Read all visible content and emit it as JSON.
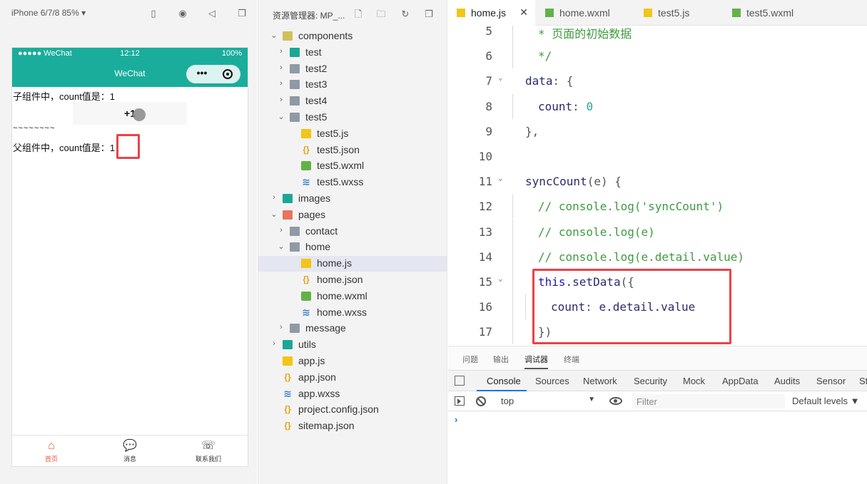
{
  "simulator": {
    "device": "iPhone 6/7/8 85% ▾",
    "status": {
      "carrier": "●●●●● WeChat",
      "time": "12:12",
      "battery": "100%"
    },
    "nav_title": "WeChat",
    "child_count_text": "子组件中，count值是：1",
    "plus_button": "+1",
    "separator": "~~~~~~~~",
    "parent_count_label": "父组件中，count值是：",
    "parent_count_value": "1",
    "tabs": [
      {
        "label": "首页",
        "icon": "home-icon",
        "active": true
      },
      {
        "label": "消息",
        "icon": "message-icon",
        "active": false
      },
      {
        "label": "联系我们",
        "icon": "contact-icon",
        "active": false
      }
    ]
  },
  "explorer": {
    "title": "资源管理器: MP_...",
    "tree": [
      {
        "label": "components",
        "type": "folder-comp",
        "chevron": "⌄",
        "level": 0
      },
      {
        "label": "test",
        "type": "folder-teal",
        "chevron": "›",
        "level": 1
      },
      {
        "label": "test2",
        "type": "folder",
        "chevron": "›",
        "level": 1
      },
      {
        "label": "test3",
        "type": "folder",
        "chevron": "›",
        "level": 1
      },
      {
        "label": "test4",
        "type": "folder",
        "chevron": "›",
        "level": 1
      },
      {
        "label": "test5",
        "type": "folder",
        "chevron": "⌄",
        "level": 1
      },
      {
        "label": "test5.js",
        "type": "js",
        "chevron": "",
        "level": 2
      },
      {
        "label": "test5.json",
        "type": "json",
        "chevron": "",
        "level": 2
      },
      {
        "label": "test5.wxml",
        "type": "wxml",
        "chevron": "",
        "level": 2
      },
      {
        "label": "test5.wxss",
        "type": "wxss",
        "chevron": "",
        "level": 2
      },
      {
        "label": "images",
        "type": "folder-teal",
        "chevron": "›",
        "level": 0
      },
      {
        "label": "pages",
        "type": "folder-pages",
        "chevron": "⌄",
        "level": 0
      },
      {
        "label": "contact",
        "type": "folder",
        "chevron": "›",
        "level": 1
      },
      {
        "label": "home",
        "type": "folder",
        "chevron": "⌄",
        "level": 1
      },
      {
        "label": "home.js",
        "type": "js",
        "chevron": "",
        "level": 2,
        "selected": true
      },
      {
        "label": "home.json",
        "type": "json",
        "chevron": "",
        "level": 2
      },
      {
        "label": "home.wxml",
        "type": "wxml",
        "chevron": "",
        "level": 2
      },
      {
        "label": "home.wxss",
        "type": "wxss",
        "chevron": "",
        "level": 2
      },
      {
        "label": "message",
        "type": "folder",
        "chevron": "›",
        "level": 1
      },
      {
        "label": "utils",
        "type": "folder-teal",
        "chevron": "›",
        "level": 0
      },
      {
        "label": "app.js",
        "type": "js",
        "chevron": "",
        "level": 0
      },
      {
        "label": "app.json",
        "type": "json",
        "chevron": "",
        "level": 0
      },
      {
        "label": "app.wxss",
        "type": "wxss",
        "chevron": "",
        "level": 0
      },
      {
        "label": "project.config.json",
        "type": "json",
        "chevron": "",
        "level": 0
      },
      {
        "label": "sitemap.json",
        "type": "json",
        "chevron": "",
        "level": 0
      }
    ]
  },
  "editor": {
    "tabs": [
      {
        "label": "home.js",
        "type": "js",
        "active": true,
        "close": "✕"
      },
      {
        "label": "home.wxml",
        "type": "wxml",
        "active": false
      },
      {
        "label": "test5.js",
        "type": "js",
        "active": false
      },
      {
        "label": "test5.wxml",
        "type": "wxml",
        "active": false
      }
    ],
    "lines": [
      {
        "n": "5",
        "indent": 1,
        "fold": "",
        "tokens": [
          [
            "comment",
            "* 页面的初始数据"
          ]
        ]
      },
      {
        "n": "6",
        "indent": 1,
        "fold": "",
        "tokens": [
          [
            "comment",
            "*/"
          ]
        ]
      },
      {
        "n": "7",
        "indent": 0,
        "fold": "⌄",
        "tokens": [
          [
            "fn",
            "data"
          ],
          [
            "punct",
            ": {"
          ]
        ]
      },
      {
        "n": "8",
        "indent": 1,
        "fold": "",
        "tokens": [
          [
            "fn",
            "count"
          ],
          [
            "punct",
            ": "
          ],
          [
            "num",
            "0"
          ]
        ]
      },
      {
        "n": "9",
        "indent": 0,
        "fold": "",
        "tokens": [
          [
            "punct",
            "},"
          ]
        ]
      },
      {
        "n": "10",
        "indent": 0,
        "fold": "",
        "tokens": []
      },
      {
        "n": "11",
        "indent": 0,
        "fold": "⌄",
        "tokens": [
          [
            "fn",
            "syncCount"
          ],
          [
            "punct",
            "(e) {"
          ]
        ]
      },
      {
        "n": "12",
        "indent": 1,
        "fold": "",
        "tokens": [
          [
            "comment",
            "// console.log('syncCount')"
          ]
        ]
      },
      {
        "n": "13",
        "indent": 1,
        "fold": "",
        "tokens": [
          [
            "comment",
            "// console.log(e)"
          ]
        ]
      },
      {
        "n": "14",
        "indent": 1,
        "fold": "",
        "tokens": [
          [
            "comment",
            "// console.log(e.detail.value)"
          ]
        ]
      },
      {
        "n": "15",
        "indent": 1,
        "fold": "⌄",
        "tokens": [
          [
            "kw",
            "this"
          ],
          [
            "fn",
            ".setData"
          ],
          [
            "punct",
            "({"
          ]
        ]
      },
      {
        "n": "16",
        "indent": 2,
        "fold": "",
        "tokens": [
          [
            "fn",
            "count"
          ],
          [
            "punct",
            ": "
          ],
          [
            "fn",
            "e.detail.value"
          ]
        ]
      },
      {
        "n": "17",
        "indent": 1,
        "fold": "",
        "tokens": [
          [
            "punct",
            "})"
          ]
        ]
      }
    ]
  },
  "bottom_panel": {
    "tabs": [
      {
        "label": "问题",
        "active": false
      },
      {
        "label": "输出",
        "active": false
      },
      {
        "label": "调试器",
        "active": true
      },
      {
        "label": "终端",
        "active": false
      }
    ],
    "devtools_tabs": [
      "Console",
      "Sources",
      "Network",
      "Security",
      "Mock",
      "AppData",
      "Audits",
      "Sensor",
      "St"
    ],
    "active_devtools_tab": "Console",
    "context": "top",
    "context_arrow": "▼",
    "filter_placeholder": "Filter",
    "levels": "Default levels ▼",
    "prompt": "›"
  },
  "colors": {
    "accent": "#1aad9c",
    "highlight": "#e8434a",
    "tab_active": "#e8543f"
  }
}
